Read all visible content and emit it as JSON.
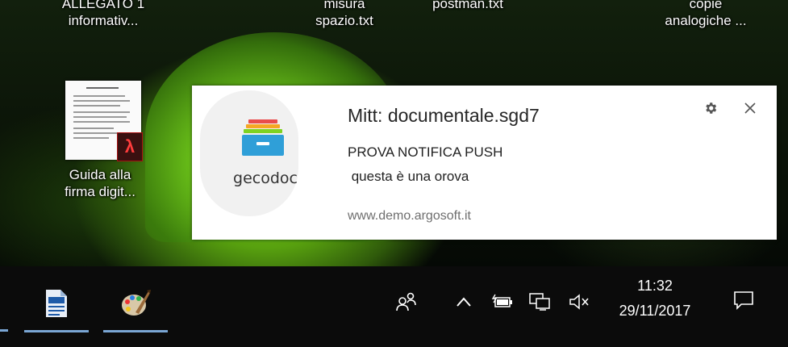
{
  "desktop": {
    "icons": [
      {
        "label": "ALLEGATO 1\ninformativ..."
      },
      {
        "label": "misura\nspazio.txt"
      },
      {
        "label": "postman.txt"
      },
      {
        "label": "copie\nanalogiche ..."
      },
      {
        "label": "Guida alla\nfirma digit..."
      }
    ]
  },
  "notification": {
    "app_name": "gecodoc",
    "title": "Mitt: documentale.sgd7",
    "subtitle": "PROVA NOTIFICA PUSH",
    "body": " questa è una orova",
    "source": "www.demo.argosoft.it",
    "icons": {
      "settings": "gear-icon",
      "close": "close-icon"
    }
  },
  "taskbar": {
    "apps": [
      {
        "icon": "writer-document-icon"
      },
      {
        "icon": "paint-palette-icon"
      }
    ],
    "tray_icons": [
      "people-icon",
      "chevron-up-icon",
      "battery-icon",
      "network-icon",
      "volume-muted-icon"
    ],
    "clock": {
      "time": "11:32",
      "date": "29/11/2017"
    },
    "action_center_icon": "action-center-icon"
  },
  "colors": {
    "taskbar_bg": "#0b0b0b",
    "taskbar_accent": "#7aa6d4",
    "toast_bg": "#ffffff",
    "pdf_red": "#ff3c3c"
  }
}
